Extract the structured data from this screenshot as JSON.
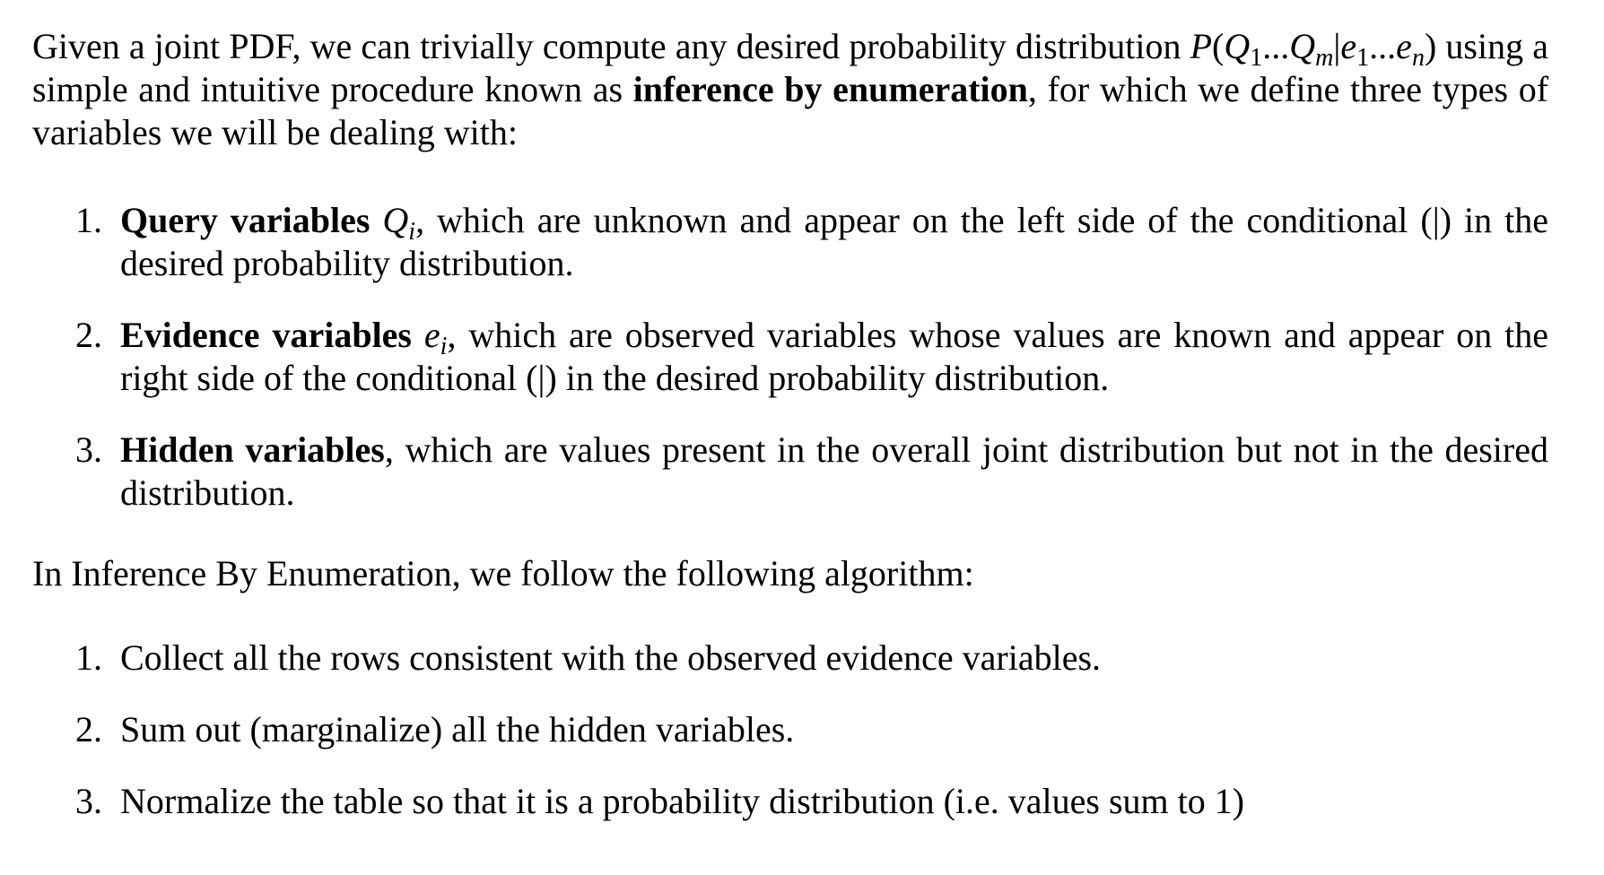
{
  "intro": {
    "text_before_formula": "Given a joint PDF, we can trivially compute any desired probability distribution ",
    "formula_P": "P",
    "formula_open": "(",
    "formula_Q": "Q",
    "formula_sub1": "1",
    "formula_dots1": "...",
    "formula_Qm": "Q",
    "formula_sub_m": "m",
    "formula_bar": "|",
    "formula_e": "e",
    "formula_sub_e1": "1",
    "formula_dots2": "...",
    "formula_en": "e",
    "formula_sub_n": "n",
    "formula_close": ")",
    "text_after_formula": " using a simple and intuitive procedure known as ",
    "bold_term": "inference by enumeration",
    "text_end": ", for which we define three types of variables we will be dealing with:"
  },
  "variable_types": [
    {
      "number": "1.",
      "bold": "Query variables",
      "sym": "Q",
      "sub": "i",
      "rest": ", which are unknown and appear on the left side of the conditional (|) in the desired probability distribution."
    },
    {
      "number": "2.",
      "bold": "Evidence variables",
      "sym": "e",
      "sub": "i",
      "rest": ", which are observed variables whose values are known and appear on the right side of the conditional (|) in the desired probability distribution."
    },
    {
      "number": "3.",
      "bold": "Hidden variables",
      "rest": ", which are values present in the overall joint distribution but not in the desired distribution."
    }
  ],
  "algorithm_intro": "In Inference By Enumeration, we follow the following algorithm:",
  "algorithm_steps": [
    {
      "number": "1.",
      "text": "Collect all the rows consistent with the observed evidence variables."
    },
    {
      "number": "2.",
      "text": "Sum out (marginalize) all the hidden variables."
    },
    {
      "number": "3.",
      "text": "Normalize the table so that it is a probability distribution (i.e. values sum to 1)"
    }
  ]
}
